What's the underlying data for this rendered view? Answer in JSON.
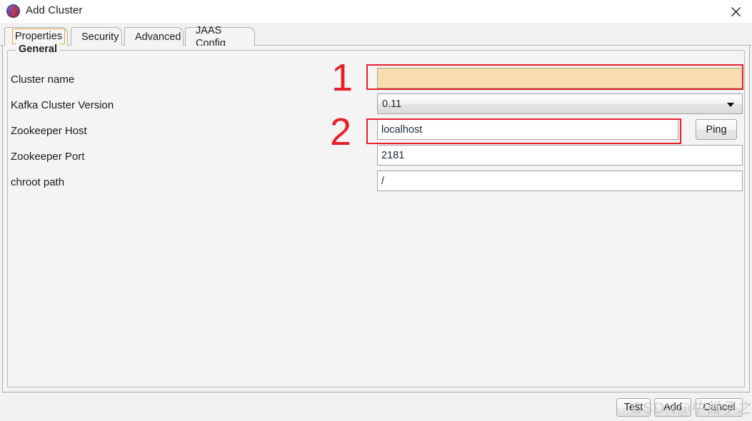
{
  "window": {
    "title": "Add Cluster",
    "icon": "kafka-tool-logo",
    "close_label": "✕"
  },
  "tabs": [
    {
      "label": "Properties",
      "selected": true
    },
    {
      "label": "Security",
      "selected": false
    },
    {
      "label": "Advanced",
      "selected": false
    },
    {
      "label": "JAAS Config",
      "selected": false
    }
  ],
  "group": {
    "title": "General"
  },
  "form": {
    "rows": [
      {
        "label": "Cluster name",
        "type": "text",
        "value": "",
        "highlight": "peach"
      },
      {
        "label": "Kafka Cluster Version",
        "type": "combo",
        "value": "0.11",
        "highlight": "none"
      },
      {
        "label": "Zookeeper Host",
        "type": "text",
        "value": "localhost",
        "highlight": "none"
      },
      {
        "label": "Zookeeper Port",
        "type": "text",
        "value": "2181",
        "highlight": "none"
      },
      {
        "label": "chroot path",
        "type": "text",
        "value": "/",
        "highlight": "none"
      }
    ],
    "ping_button": "Ping"
  },
  "annotations": {
    "marker_one": "1",
    "marker_two": "2",
    "color": "#e8202a"
  },
  "footer": {
    "buttons": [
      {
        "label": "Test"
      },
      {
        "label": "Add"
      },
      {
        "label": "Cancel"
      }
    ]
  },
  "watermark": {
    "latin": "CSDN",
    "cjk": "@中微子之海"
  },
  "colors": {
    "accent_tab_focus": "#eaa33a",
    "highlight_field": "#f8ddb0",
    "annotation_red": "#e8202a",
    "window_bg": "#f1f1f1",
    "panel_bg": "#f4f4f4"
  }
}
